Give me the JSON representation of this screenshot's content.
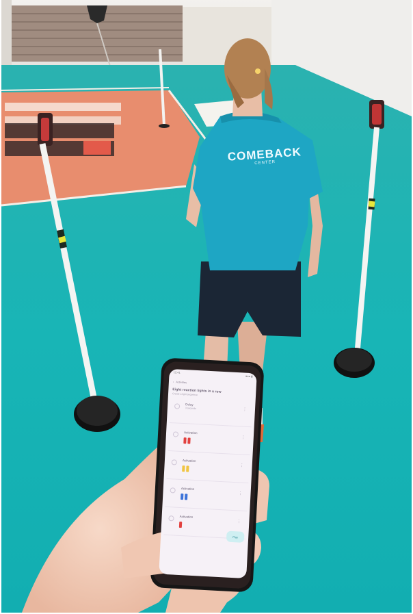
{
  "shirt": {
    "line1": "COMEBACK",
    "line2": "CENTER"
  },
  "phone": {
    "status_time": "12:41",
    "status_right": "●●● ▮",
    "nav_back": "‹",
    "nav_label": "Activities",
    "title": "Eight reaction lights in a row",
    "subtitle": "Create a light sequence",
    "rows": [
      {
        "label": "Delay",
        "sub": "3 seconds",
        "chips": []
      },
      {
        "label": "Activation",
        "sub": "",
        "chips": [
          "#e2413f",
          "#e2413f"
        ]
      },
      {
        "label": "Activation",
        "sub": "",
        "chips": [
          "#f0c542",
          "#f0c542"
        ]
      },
      {
        "label": "Activation",
        "sub": "",
        "chips": [
          "#3d73d9",
          "#3d73d9"
        ]
      },
      {
        "label": "Activation",
        "sub": "",
        "chips": [
          "#e2413f"
        ]
      }
    ],
    "fab_label": "Play"
  },
  "colors": {
    "court_teal": "#1fb7b6",
    "court_orange": "#e98a6c",
    "shirt_blue": "#1ea8c6",
    "shorts_navy": "#1b2635"
  }
}
